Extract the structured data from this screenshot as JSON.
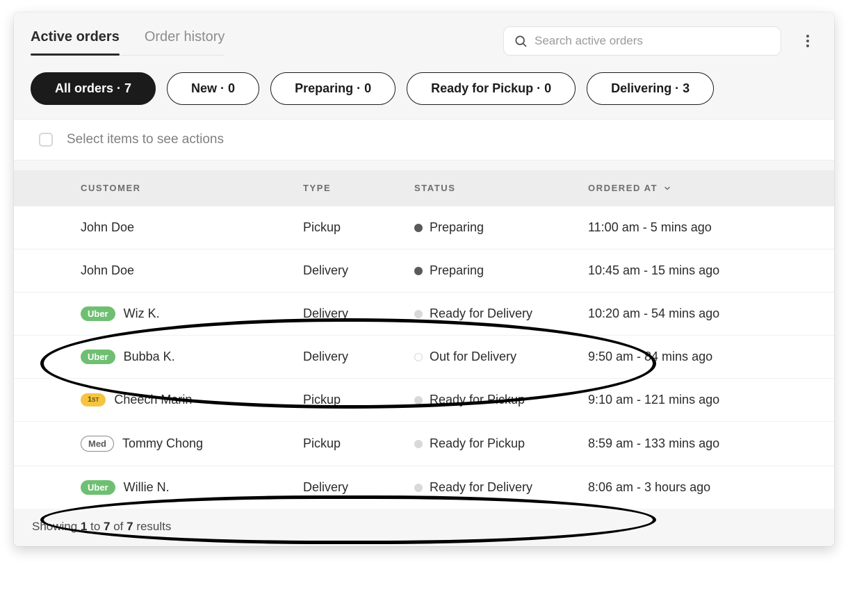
{
  "tabs": {
    "active": "Active orders",
    "history": "Order history"
  },
  "search": {
    "placeholder": "Search active orders"
  },
  "filters": [
    {
      "label": "All orders",
      "count": 7,
      "active": true
    },
    {
      "label": "New",
      "count": 0,
      "active": false
    },
    {
      "label": "Preparing",
      "count": 0,
      "active": false
    },
    {
      "label": "Ready for Pickup",
      "count": 0,
      "active": false
    },
    {
      "label": "Delivering",
      "count": 3,
      "active": false
    }
  ],
  "select_hint": "Select items to see actions",
  "columns": {
    "customer": "CUSTOMER",
    "type": "TYPE",
    "status": "STATUS",
    "ordered_at": "ORDERED AT"
  },
  "rows": [
    {
      "badge": null,
      "customer": "John Doe",
      "type": "Pickup",
      "status": "Preparing",
      "dot": "dark",
      "time": "11:00 am",
      "ago": "5 mins ago"
    },
    {
      "badge": null,
      "customer": "John Doe",
      "type": "Delivery",
      "status": "Preparing",
      "dot": "dark",
      "time": "10:45 am",
      "ago": "15 mins ago"
    },
    {
      "badge": "Uber",
      "customer": "Wiz K.",
      "type": "Delivery",
      "status": "Ready for Delivery",
      "dot": "light",
      "time": "10:20 am",
      "ago": "54 mins ago"
    },
    {
      "badge": "Uber",
      "customer": "Bubba K.",
      "type": "Delivery",
      "status": "Out for Delivery",
      "dot": "white",
      "time": "9:50 am",
      "ago": "84 mins ago"
    },
    {
      "badge": "1ST",
      "customer": "Cheech Marin",
      "type": "Pickup",
      "status": "Ready for Pickup",
      "dot": "light",
      "time": "9:10 am",
      "ago": "121 mins ago"
    },
    {
      "badge": "Med",
      "customer": "Tommy Chong",
      "type": "Pickup",
      "status": "Ready for Pickup",
      "dot": "light",
      "time": "8:59 am",
      "ago": "133 mins ago"
    },
    {
      "badge": "Uber",
      "customer": "Willie N.",
      "type": "Delivery",
      "status": "Ready for Delivery",
      "dot": "light",
      "time": "8:06 am",
      "ago": "3 hours ago"
    }
  ],
  "footer": {
    "prefix": "Showing ",
    "from": "1",
    "mid1": " to ",
    "to": "7",
    "mid2": " of ",
    "total": "7",
    "suffix": " results"
  },
  "annotations": [
    {
      "rows": [
        2,
        3
      ]
    },
    {
      "rows": [
        6
      ]
    }
  ]
}
